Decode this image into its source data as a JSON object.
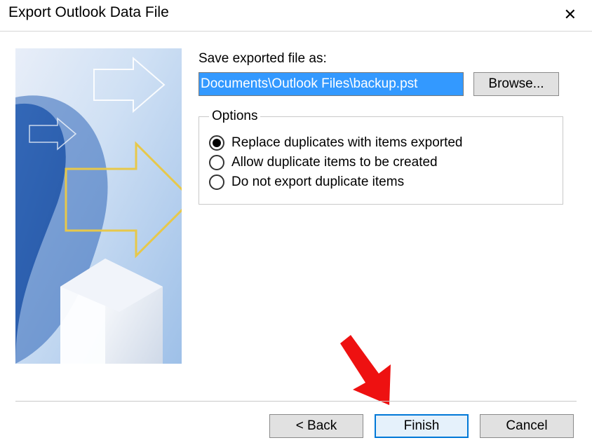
{
  "window": {
    "title": "Export Outlook Data File"
  },
  "form": {
    "save_label": "Save exported file as:",
    "file_path": "Documents\\Outlook Files\\backup.pst",
    "browse_label": "Browse..."
  },
  "options": {
    "legend": "Options",
    "items": [
      {
        "label": "Replace duplicates with items exported",
        "selected": true
      },
      {
        "label": "Allow duplicate items to be created",
        "selected": false
      },
      {
        "label": "Do not export duplicate items",
        "selected": false
      }
    ]
  },
  "buttons": {
    "back": "< Back",
    "finish": "Finish",
    "cancel": "Cancel"
  }
}
